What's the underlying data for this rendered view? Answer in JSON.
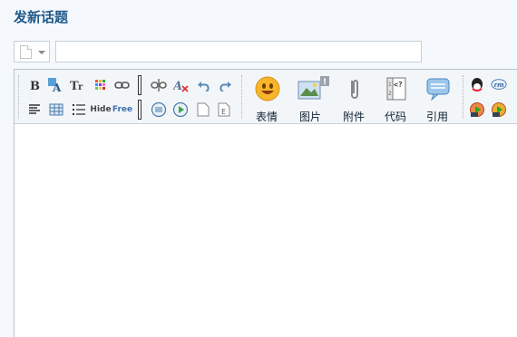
{
  "page": {
    "title": "发新话题"
  },
  "subject": {
    "value": "",
    "placeholder": ""
  },
  "toolbar": {
    "small_row1": [
      {
        "name": "bold-icon",
        "glyph": "B"
      },
      {
        "name": "color-icon",
        "glyph": "A"
      },
      {
        "name": "font-size-icon",
        "glyph": "Tт"
      },
      {
        "name": "palette-icon",
        "glyph": ""
      },
      {
        "name": "link-icon",
        "glyph": ""
      }
    ],
    "small_row2": [
      {
        "name": "align-icon",
        "glyph": ""
      },
      {
        "name": "table-icon",
        "glyph": ""
      },
      {
        "name": "list-icon",
        "glyph": ""
      },
      {
        "name": "hide-icon",
        "glyph": "Hide"
      },
      {
        "name": "free-icon",
        "glyph": "Free"
      }
    ],
    "hide_label": "Hide",
    "free_label": "Free",
    "big_buttons": [
      {
        "name": "emoticon-button",
        "label": "表情"
      },
      {
        "name": "image-button",
        "label": "图片"
      },
      {
        "name": "attachment-button",
        "label": "附件"
      },
      {
        "name": "code-button",
        "label": "代码"
      },
      {
        "name": "quote-button",
        "label": "引用"
      }
    ],
    "code_icon_text": "<?"
  }
}
